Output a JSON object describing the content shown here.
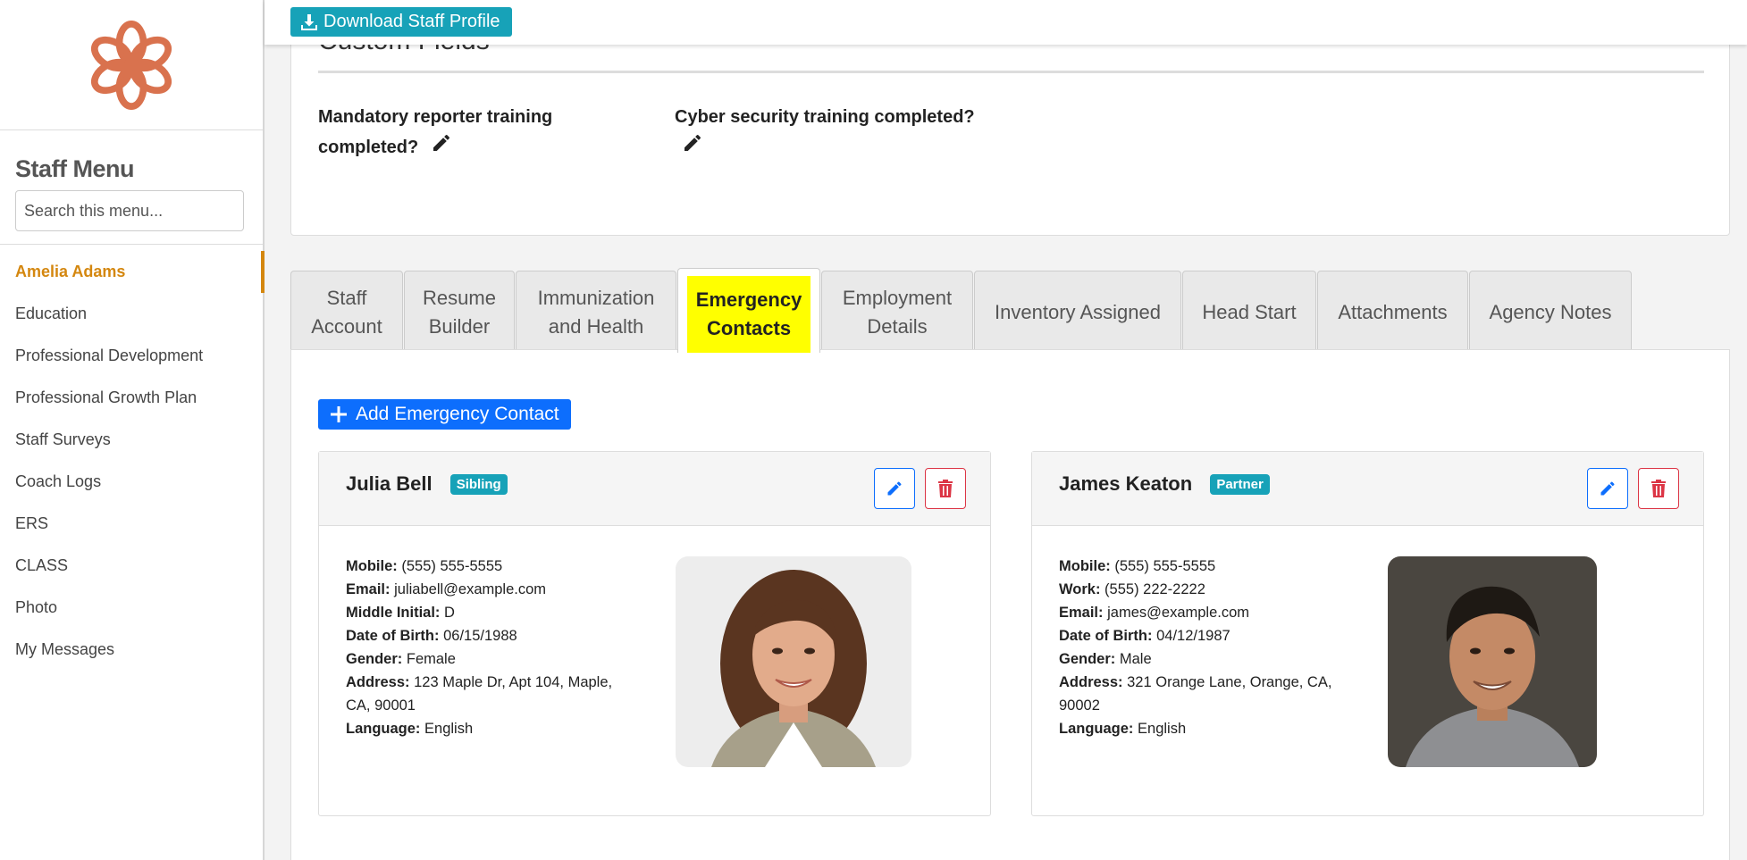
{
  "topbar": {
    "download_label": "Download Staff Profile"
  },
  "sidebar": {
    "title": "Staff Menu",
    "search_placeholder": "Search this menu...",
    "items": [
      {
        "label": "Amelia Adams",
        "active": true
      },
      {
        "label": "Education"
      },
      {
        "label": "Professional Development"
      },
      {
        "label": "Professional Growth Plan"
      },
      {
        "label": "Staff Surveys"
      },
      {
        "label": "Coach Logs"
      },
      {
        "label": "ERS"
      },
      {
        "label": "CLASS"
      },
      {
        "label": "Photo"
      },
      {
        "label": "My Messages"
      }
    ]
  },
  "custom_fields": {
    "title": "Custom Fields",
    "fields": [
      {
        "label": "Mandatory reporter training completed?"
      },
      {
        "label": "Cyber security training completed?"
      }
    ]
  },
  "tabs": [
    {
      "label": "Staff Account"
    },
    {
      "label": "Resume Builder"
    },
    {
      "label": "Immunization and Health"
    },
    {
      "label": "Emergency Contacts",
      "active": true
    },
    {
      "label": "Employment Details"
    },
    {
      "label": "Inventory Assigned"
    },
    {
      "label": "Head Start"
    },
    {
      "label": "Attachments"
    },
    {
      "label": "Agency Notes"
    }
  ],
  "add_contact_label": "Add Emergency Contact",
  "contacts": [
    {
      "name": "Julia Bell",
      "relation": "Sibling",
      "details": [
        {
          "label": "Mobile:",
          "value": "(555) 555-5555"
        },
        {
          "label": "Email:",
          "value": "juliabell@example.com"
        },
        {
          "label": "Middle Initial:",
          "value": "D"
        },
        {
          "label": "Date of Birth:",
          "value": "06/15/1988"
        },
        {
          "label": "Gender:",
          "value": "Female"
        },
        {
          "label": "Address:",
          "value": "123 Maple Dr, Apt 104, Maple, CA, 90001"
        },
        {
          "label": "Language:",
          "value": "English"
        }
      ]
    },
    {
      "name": "James Keaton",
      "relation": "Partner",
      "details": [
        {
          "label": "Mobile:",
          "value": "(555) 555-5555"
        },
        {
          "label": "Work:",
          "value": "(555) 222-2222"
        },
        {
          "label": "Email:",
          "value": "james@example.com"
        },
        {
          "label": "Date of Birth:",
          "value": "04/12/1987"
        },
        {
          "label": "Gender:",
          "value": "Male"
        },
        {
          "label": "Address:",
          "value": "321 Orange Lane, Orange, CA, 90002"
        },
        {
          "label": "Language:",
          "value": "English"
        }
      ]
    }
  ],
  "colors": {
    "accent_orange": "#d4870f",
    "logo": "#d9724e",
    "teal": "#17a2b8",
    "primary_blue": "#0d6efd",
    "danger_red": "#dc3545",
    "tab_highlight": "#ffff00"
  },
  "icons": {
    "logo": "flower-logo-icon",
    "download": "download-icon",
    "edit": "pencil-icon",
    "delete": "trash-icon",
    "add": "plus-icon"
  }
}
